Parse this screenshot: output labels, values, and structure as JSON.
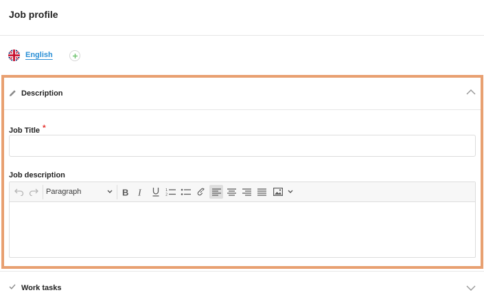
{
  "page": {
    "title": "Job profile"
  },
  "language": {
    "current": "English",
    "flag_icon": "uk-flag-icon",
    "add_icon": "plus-circle-icon",
    "link_color": "#2a8fd6"
  },
  "description_section": {
    "title": "Description",
    "icon": "pencil-icon",
    "collapse_icon": "chevron-up-icon",
    "highlight_color": "#e8a071",
    "job_title": {
      "label": "Job Title",
      "required_marker": "*",
      "value": "",
      "placeholder": ""
    },
    "job_description": {
      "label": "Job description",
      "toolbar": {
        "undo_icon": "undo-icon",
        "redo_icon": "redo-icon",
        "format_select": "Paragraph",
        "bold_icon": "bold-icon",
        "italic_icon": "italic-icon",
        "underline_icon": "underline-icon",
        "numbered_list_icon": "numbered-list-icon",
        "bullet_list_icon": "bullet-list-icon",
        "link_icon": "link-icon",
        "align_left_icon": "align-left-icon",
        "align_center_icon": "align-center-icon",
        "align_right_icon": "align-right-icon",
        "align_justify_icon": "align-justify-icon",
        "image_icon": "image-icon",
        "image_dropdown_icon": "chevron-down-icon"
      },
      "content": ""
    }
  },
  "work_tasks_section": {
    "title": "Work tasks",
    "icon": "check-icon",
    "expand_icon": "chevron-down-icon"
  }
}
